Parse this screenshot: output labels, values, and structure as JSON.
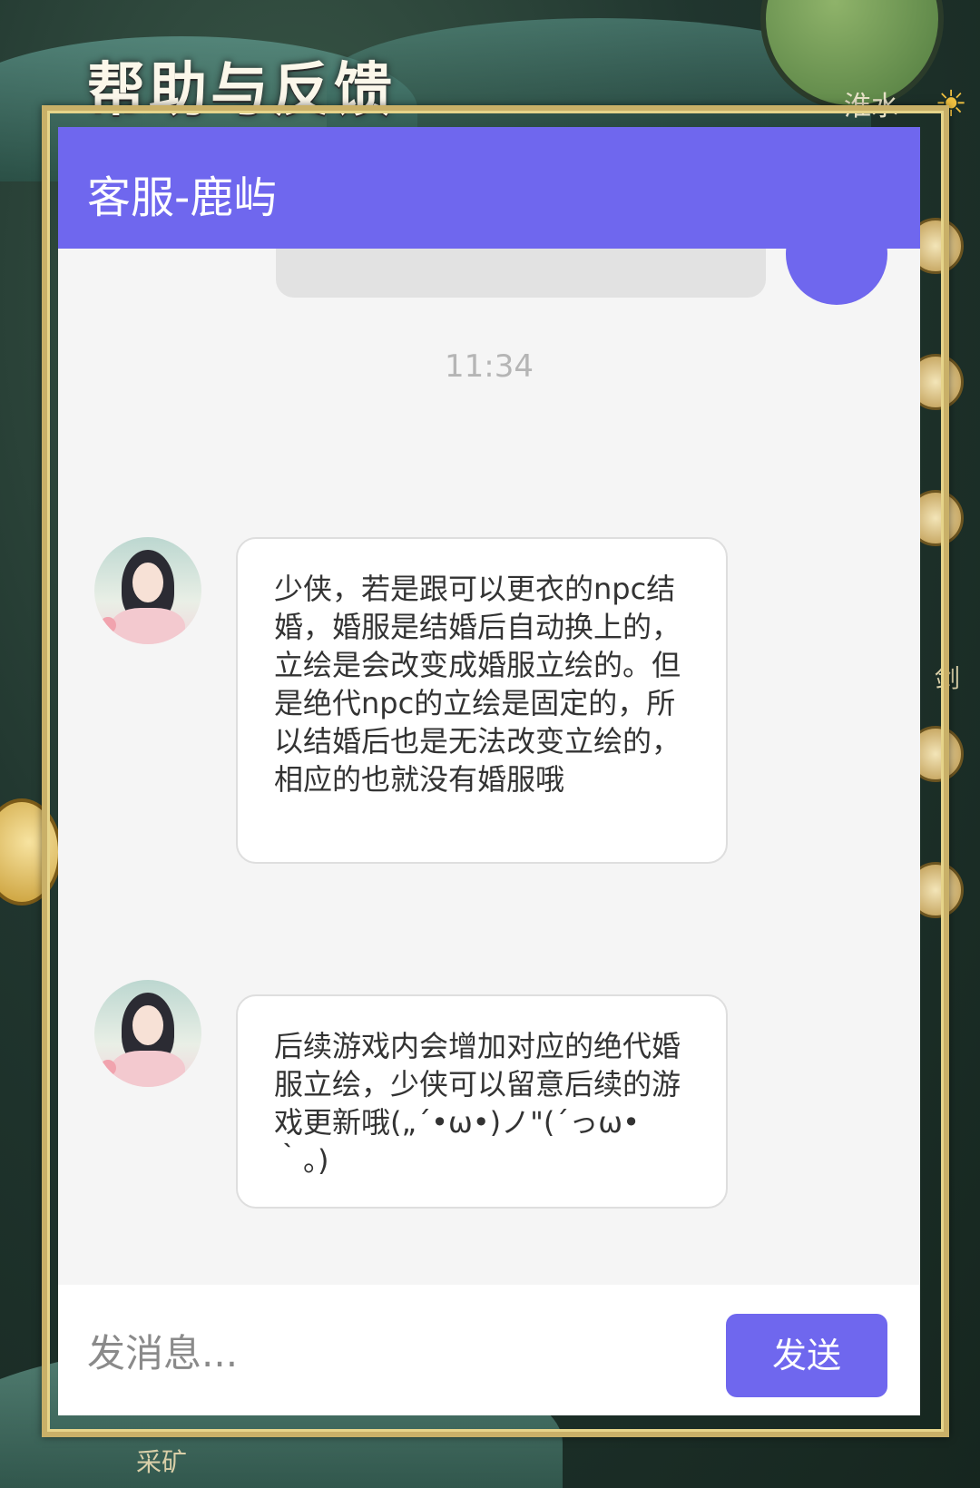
{
  "page": {
    "title": "帮助与反馈"
  },
  "backdrop": {
    "minimap_label": "淮水",
    "side_label": "剑",
    "bottom_label": "采矿"
  },
  "chat": {
    "header_title": "客服-鹿屿",
    "timestamp": "11:34",
    "messages": [
      {
        "sender": "agent",
        "text": "少侠，若是跟可以更衣的npc结婚，婚服是结婚后自动换上的，立绘是会改变成婚服立绘的。但是绝代npc的立绘是固定的，所以结婚后也是无法改变立绘的，相应的也就没有婚服哦"
      },
      {
        "sender": "agent",
        "text": "后续游戏内会增加对应的绝代婚服立绘，少侠可以留意后续的游戏更新哦(„´•ω•)ノ\"(´っω•｀。)"
      }
    ]
  },
  "composer": {
    "placeholder": "发消息...",
    "send_label": "发送"
  },
  "toolbar": {
    "icons": [
      "emoji-icon",
      "image-icon",
      "folder-icon",
      "mute-icon"
    ]
  },
  "colors": {
    "accent": "#6f67ee",
    "frame": "#c9b068"
  }
}
